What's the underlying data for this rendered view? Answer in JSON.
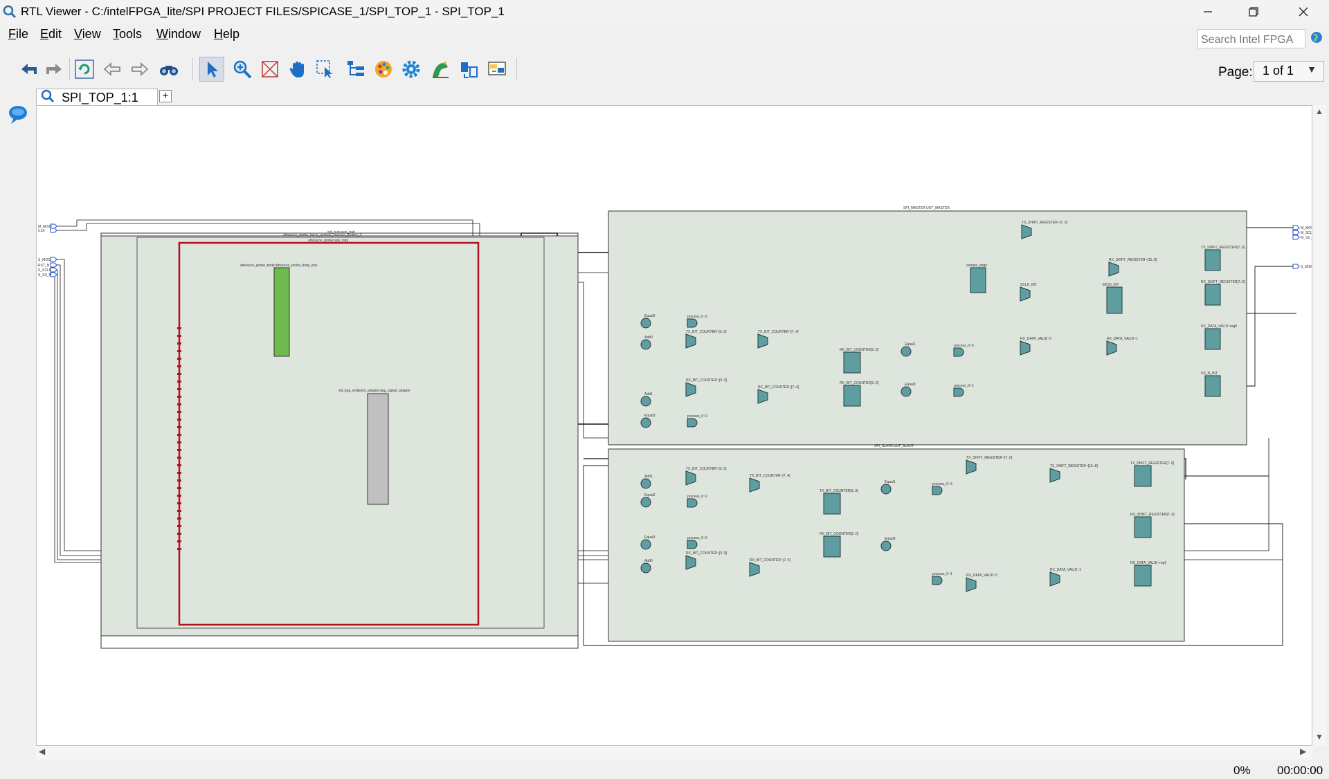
{
  "window": {
    "title": "RTL Viewer - C:/intelFPGA_lite/SPI PROJECT FILES/SPICASE_1/SPI_TOP_1 - SPI_TOP_1",
    "controls": [
      "minimize",
      "restore",
      "close"
    ]
  },
  "menu": [
    {
      "key": "F",
      "rest": "ile"
    },
    {
      "key": "E",
      "rest": "dit"
    },
    {
      "key": "V",
      "rest": "iew"
    },
    {
      "key": "T",
      "rest": "ools"
    },
    {
      "key": "W",
      "rest": "indow"
    },
    {
      "key": "H",
      "rest": "elp"
    }
  ],
  "search": {
    "placeholder": "Search Intel FPGA"
  },
  "toolbar": {
    "tools": [
      "back-icon",
      "forward-icon",
      "refresh-icon",
      "go-back-icon",
      "go-forward-icon",
      "find-icon",
      "select-icon",
      "zoom-icon",
      "fit-icon",
      "pan-icon",
      "area-select-icon",
      "hierarchy-icon",
      "color-palette-icon",
      "settings-icon",
      "netlist-icon",
      "export-icon",
      "filter-icon"
    ],
    "active": "select-icon"
  },
  "page": {
    "label": "Page:",
    "value": "1 of 1"
  },
  "tabs": [
    {
      "label": "SPI_TOP_1:1"
    }
  ],
  "tab_add": "+",
  "schematic": {
    "left_inputs": [
      "M_MISO",
      "CLK",
      "S_MOSI",
      "RST_N",
      "S_SCLK",
      "S_SS_N"
    ],
    "right_outputs": [
      "M_MOSI",
      "M_SCLK",
      "M_SS_N",
      "S_MISO"
    ],
    "blocks": {
      "hub": "sld_hub:auto_hub",
      "hub_inner": "altsource_probe_top:in_system_sources_probes_0",
      "hub_red": "altsource_probe:issp_impl",
      "probe_body": "altsource_probe_body:altsource_probe_body_inst",
      "adapter": "sld_jtag_endpoint_adapter:jtag_signal_adapter",
      "master": "SPI_MASTER:UUT_MASTER",
      "slave": "SPI_SLAVE:UUT_SLAVE"
    },
    "master_cells": [
      "TX_SHIFT_REGISTER~[7..0]",
      "RX_SHIFT_REGISTER~[15..8]",
      "TX_SHIFT_REGISTER[7..0]",
      "RX_SHIFT_REGISTER[7..0]",
      "sample_edge",
      "SCLK_INT",
      "MOSI_INT",
      "Equal2",
      "process_0~2",
      "Add0",
      "TX_BIT_COUNTER~[3..0]",
      "TX_BIT_COUNTER~[7..4]",
      "RX_BIT_COUNTER[3..0]",
      "Equal1",
      "process_0~3",
      "RX_DATA_VALID~0",
      "RX_DATA_VALID~1",
      "RX_DATA_VALID~reg0",
      "SS_N_INT",
      "Add1",
      "RX_BIT_COUNTER~[3..0]",
      "RX_BIT_COUNTER~[7..4]",
      "RX_BIT_COUNTER[3..0]",
      "Equal0",
      "process_0~1",
      "Equal3",
      "process_0~0"
    ],
    "slave_cells": [
      "TX_SHIFT_REGISTER~[7..0]",
      "TX_SHIFT_REGISTER~[15..8]",
      "TX_SHIFT_REGISTER[7..0]",
      "Add1",
      "TX_BIT_COUNTER~[3..0]",
      "TX_BIT_COUNTER~[7..4]",
      "TX_BIT_COUNTER[3..0]",
      "Equal1",
      "process_0~3",
      "Equal2",
      "process_0~2",
      "RX_SHIFT_REGISTER[7..0]",
      "Equal3",
      "process_0~0",
      "RX_BIT_COUNTER[3..0]",
      "Equal0",
      "Add0",
      "RX_BIT_COUNTER~[3..0]",
      "RX_BIT_COUNTER~[7..4]",
      "process_0~1",
      "RX_DATA_VALID~0",
      "RX_DATA_VALID~1",
      "RX_DATA_VALID~reg0"
    ]
  },
  "status": {
    "progress": "0%",
    "time": "00:00:00"
  }
}
